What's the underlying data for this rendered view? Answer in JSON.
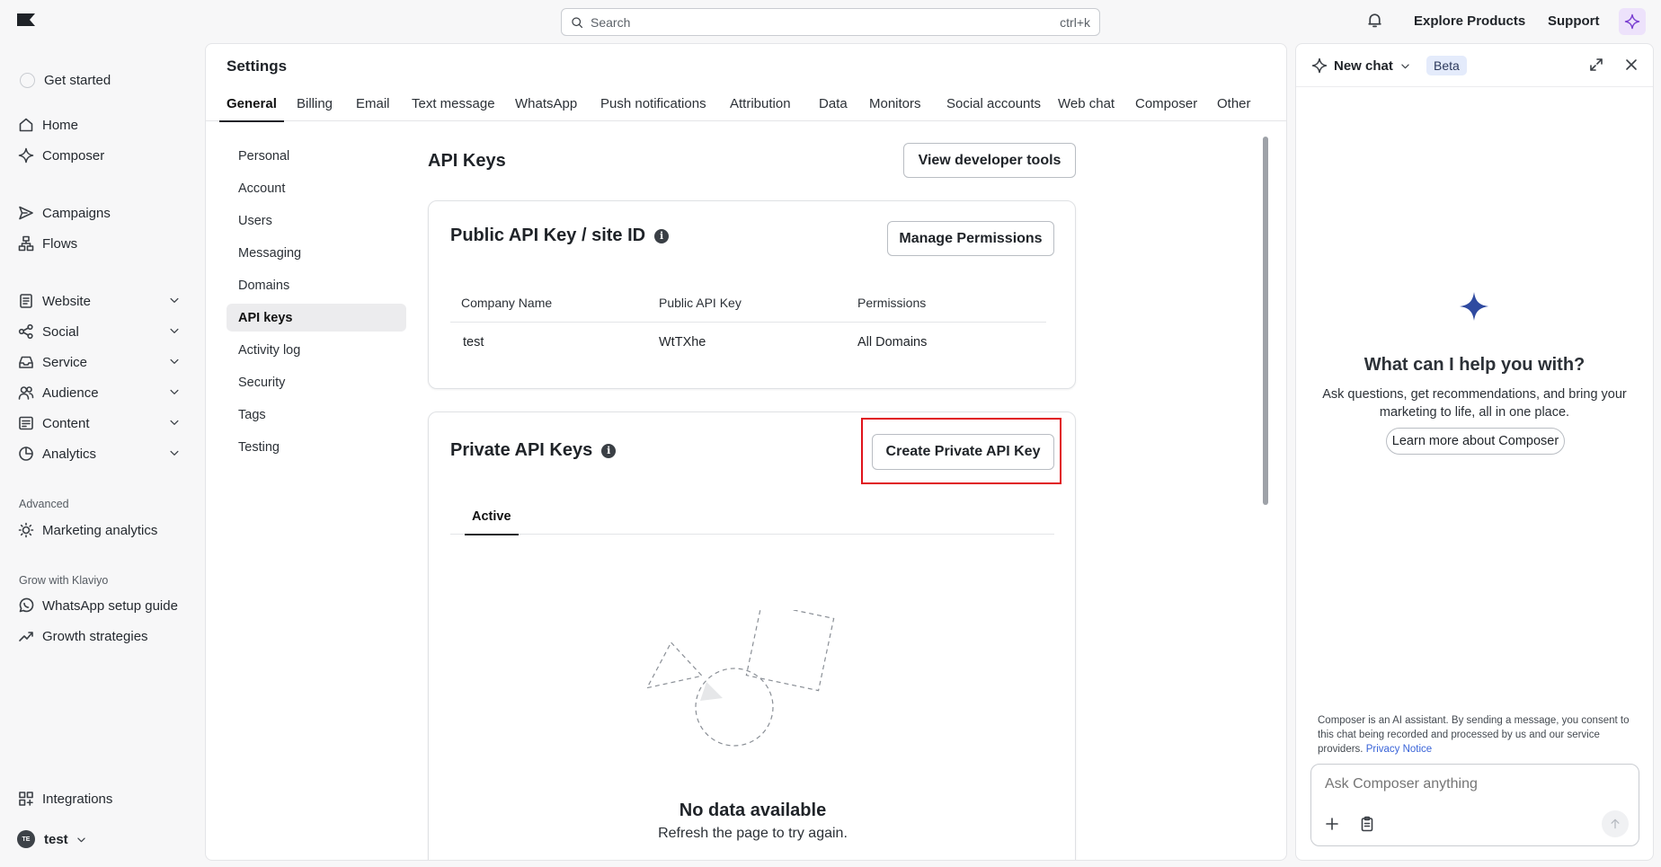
{
  "topbar": {
    "search_placeholder": "Search",
    "search_shortcut": "ctrl+k",
    "explore_label": "Explore Products",
    "support_label": "Support"
  },
  "nav": {
    "get_started": "Get started",
    "items": {
      "home": "Home",
      "composer": "Composer",
      "campaigns": "Campaigns",
      "flows": "Flows",
      "website": "Website",
      "social": "Social",
      "service": "Service",
      "audience": "Audience",
      "content": "Content",
      "analytics": "Analytics",
      "marketing_analytics": "Marketing analytics",
      "whatsapp_guide": "WhatsApp setup guide",
      "growth": "Growth strategies",
      "integrations": "Integrations"
    },
    "section_advanced": "Advanced",
    "section_grow": "Grow with Klaviyo",
    "account_name": "test",
    "account_initials": "TE"
  },
  "settings": {
    "title": "Settings",
    "tabs": [
      "General",
      "Billing",
      "Email",
      "Text message",
      "WhatsApp",
      "Push notifications",
      "Attribution",
      "Data",
      "Monitors",
      "Social accounts",
      "Web chat",
      "Composer",
      "Other"
    ],
    "subnav": [
      "Personal",
      "Account",
      "Users",
      "Messaging",
      "Domains",
      "API keys",
      "Activity log",
      "Security",
      "Tags",
      "Testing"
    ],
    "active_subnav": "API keys"
  },
  "api_keys": {
    "title": "API Keys",
    "dev_tools_label": "View developer tools",
    "public": {
      "title": "Public API Key / site ID",
      "manage_label": "Manage Permissions",
      "columns": [
        "Company Name",
        "Public API Key",
        "Permissions"
      ],
      "row": {
        "company": "test",
        "key": "WtTXhe",
        "permissions": "All Domains"
      }
    },
    "private": {
      "title": "Private API Keys",
      "create_label": "Create Private API Key",
      "tab_active": "Active",
      "empty_title": "No data available",
      "empty_sub": "Refresh the page to try again."
    }
  },
  "chat": {
    "title": "New chat",
    "badge": "Beta",
    "question": "What can I help you with?",
    "description": "Ask questions, get recommendations, and bring your marketing to life, all in one place.",
    "learn_label": "Learn more about Composer",
    "disclaimer": "Composer is an AI assistant. By sending a message, you consent to this chat being recorded and processed by us and our service providers.",
    "privacy_link": "Privacy Notice",
    "input_placeholder": "Ask Composer anything"
  },
  "colors": {
    "highlight": "#e0131b",
    "spark_blue": "#2f4aa0",
    "beta_bg": "#e4ebfb"
  }
}
